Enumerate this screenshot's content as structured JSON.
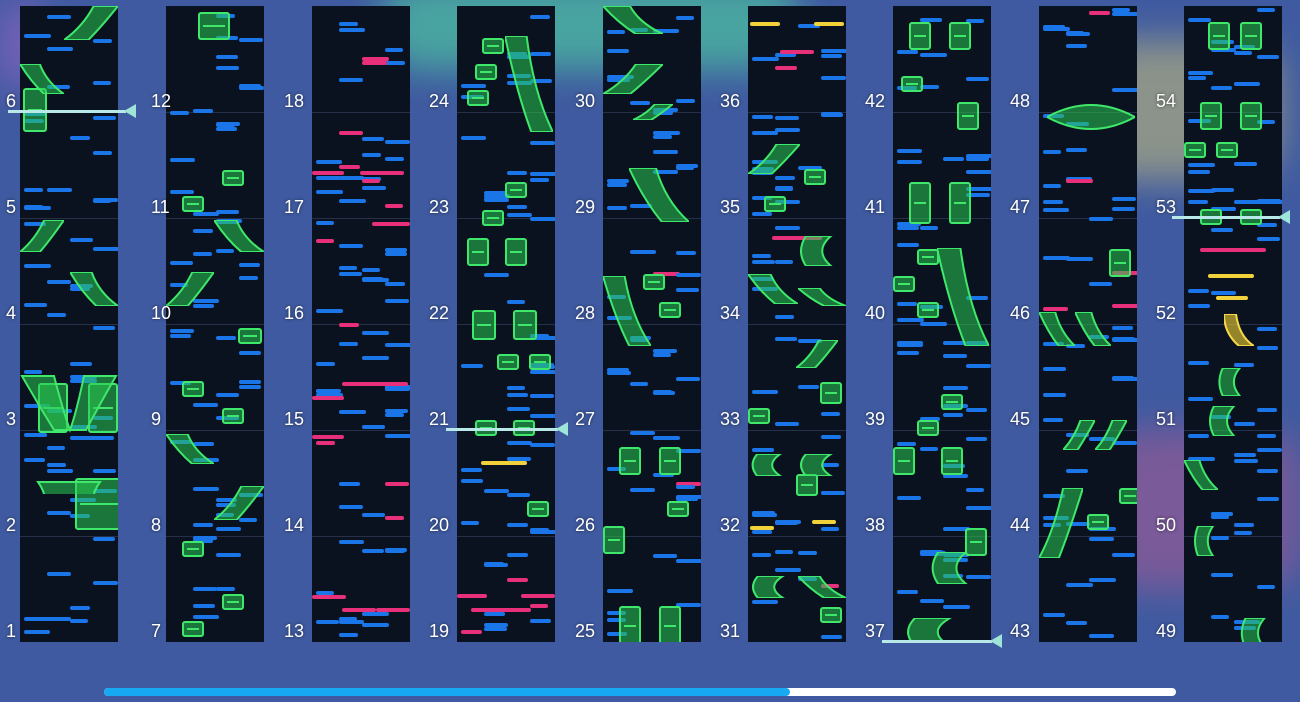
{
  "colors": {
    "tap": "#1a75e8",
    "flick": "#e8307a",
    "critical": "#f2d23a",
    "hold": "#3fe86a",
    "progress_fill": "#17a9f2",
    "background": "#3f5aa0"
  },
  "measures_per_column": 6,
  "columns": [
    {
      "labels": [
        "1",
        "2",
        "3",
        "4",
        "5",
        "6"
      ]
    },
    {
      "labels": [
        "7",
        "8",
        "9",
        "10",
        "11",
        "12"
      ]
    },
    {
      "labels": [
        "13",
        "14",
        "15",
        "16",
        "17",
        "18"
      ]
    },
    {
      "labels": [
        "19",
        "20",
        "21",
        "22",
        "23",
        "24"
      ]
    },
    {
      "labels": [
        "25",
        "26",
        "27",
        "28",
        "29",
        "30"
      ]
    },
    {
      "labels": [
        "31",
        "32",
        "33",
        "34",
        "35",
        "36"
      ]
    },
    {
      "labels": [
        "37",
        "38",
        "39",
        "40",
        "41",
        "42"
      ]
    },
    {
      "labels": [
        "43",
        "44",
        "45",
        "46",
        "47",
        "48"
      ]
    },
    {
      "labels": [
        "49",
        "50",
        "51",
        "52",
        "53",
        "54"
      ]
    }
  ],
  "playback": {
    "progress": 0.64
  },
  "icons": {
    "playhead": "playhead-marker-icon"
  }
}
